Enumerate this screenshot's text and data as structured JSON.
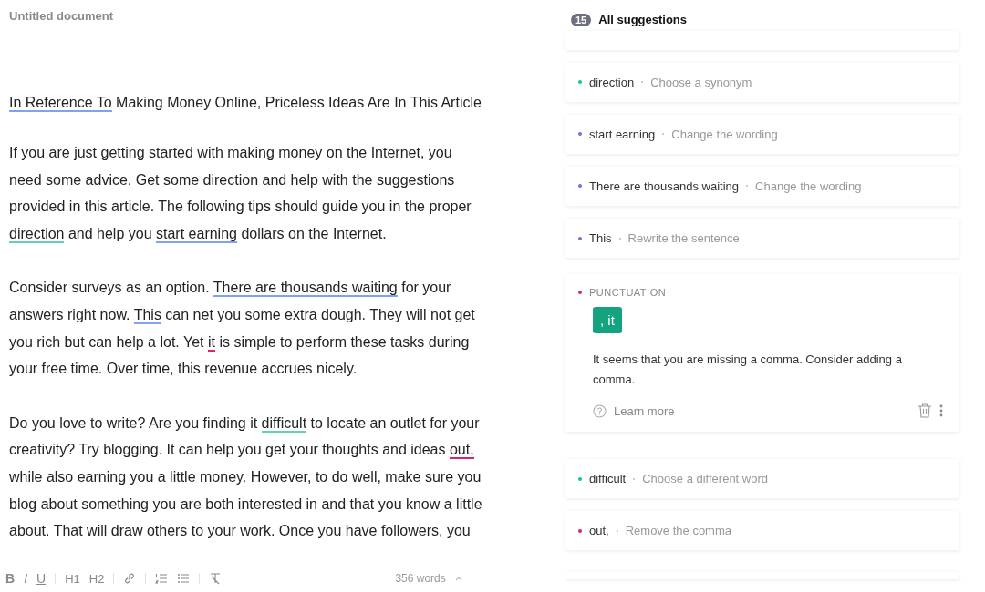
{
  "document": {
    "title": "Untitled document",
    "heading": [
      {
        "text": "In Reference To",
        "color": "#7fa3f0"
      },
      {
        "text": " Making Money Online, Priceless Ideas Are In This Article"
      }
    ],
    "paragraphs": [
      [
        [
          {
            "text": "If you are just getting started with making money on the Internet, you"
          }
        ],
        [
          {
            "text": "need some advice. Get some direction and help with the suggestions"
          }
        ],
        [
          {
            "text": "provided in this article. The following tips should guide you in the proper"
          }
        ],
        [
          {
            "text": "direction",
            "color": "#5fd3b8"
          },
          {
            "text": " and help you "
          },
          {
            "text": "start earning",
            "color": "#7fa3f0"
          },
          {
            "text": " dollars on the Internet."
          }
        ]
      ],
      [
        [
          {
            "text": "Consider surveys as an option. "
          },
          {
            "text": "There are thousands waiting",
            "color": "#7fa3f0"
          },
          {
            "text": " for your"
          }
        ],
        [
          {
            "text": "answers right now. "
          },
          {
            "text": "This",
            "color": "#7fa3f0"
          },
          {
            "text": " can net you some extra dough. They will not get"
          }
        ],
        [
          {
            "text": "you rich but can help a lot. Yet "
          },
          {
            "text": "it",
            "color": "#e0245e"
          },
          {
            "text": " is simple to perform these tasks during"
          }
        ],
        [
          {
            "text": "your free time. Over time, this revenue accrues nicely."
          }
        ]
      ],
      [
        [
          {
            "text": "Do you love to write? Are you finding it "
          },
          {
            "text": "difficult",
            "color": "#5fd3b8"
          },
          {
            "text": " to locate an outlet for your"
          }
        ],
        [
          {
            "text": "creativity? Try blogging. It can help you get your thoughts and ideas "
          },
          {
            "text": "out,",
            "color": "#e0245e"
          }
        ],
        [
          {
            "text": "while also earning you a little money. However, to do well, make sure you"
          }
        ],
        [
          {
            "text": "blog about something you are both interested in and that you know a little"
          }
        ],
        [
          {
            "text": "about. That will draw others to your work. Once you have followers, you"
          }
        ]
      ]
    ]
  },
  "toolbar": {
    "buttons": [
      {
        "kind": "bold",
        "label": "B"
      },
      {
        "kind": "italic",
        "label": "I"
      },
      {
        "kind": "underline",
        "label": "U"
      },
      {
        "kind": "sep"
      },
      {
        "kind": "heading",
        "label": "H1"
      },
      {
        "kind": "heading",
        "label": "H2"
      },
      {
        "kind": "sep"
      },
      {
        "kind": "link"
      },
      {
        "kind": "sep"
      },
      {
        "kind": "ordered"
      },
      {
        "kind": "bullet"
      },
      {
        "kind": "sep"
      },
      {
        "kind": "clear"
      }
    ],
    "word_count": "356 words"
  },
  "suggestions": {
    "count": "15",
    "title": "All suggestions",
    "items": [
      {
        "kind": "partial"
      },
      {
        "kind": "collapsed",
        "color": "#15c39a",
        "word": "direction",
        "hint": "Choose a synonym"
      },
      {
        "kind": "collapsed",
        "color": "#6d75d8",
        "word": "start earning",
        "hint": "Change the wording"
      },
      {
        "kind": "collapsed",
        "color": "#6d75d8",
        "word": "There are thousands waiting",
        "hint": "Change the wording"
      },
      {
        "kind": "collapsed",
        "color": "#6d75d8",
        "word": "This",
        "hint": "Rewrite the sentence"
      },
      {
        "kind": "expanded",
        "color": "#e0245e",
        "category": "PUNCTUATION",
        "replacement": ", it",
        "description": "It seems that you are missing a comma. Consider adding a comma.",
        "learn_more": "Learn more"
      },
      {
        "kind": "collapsed",
        "color": "#15c39a",
        "word": "difficult",
        "hint": "Choose a different word"
      },
      {
        "kind": "collapsed",
        "color": "#e0245e",
        "word": "out,",
        "hint": "Remove the comma"
      },
      {
        "kind": "edge"
      }
    ]
  }
}
